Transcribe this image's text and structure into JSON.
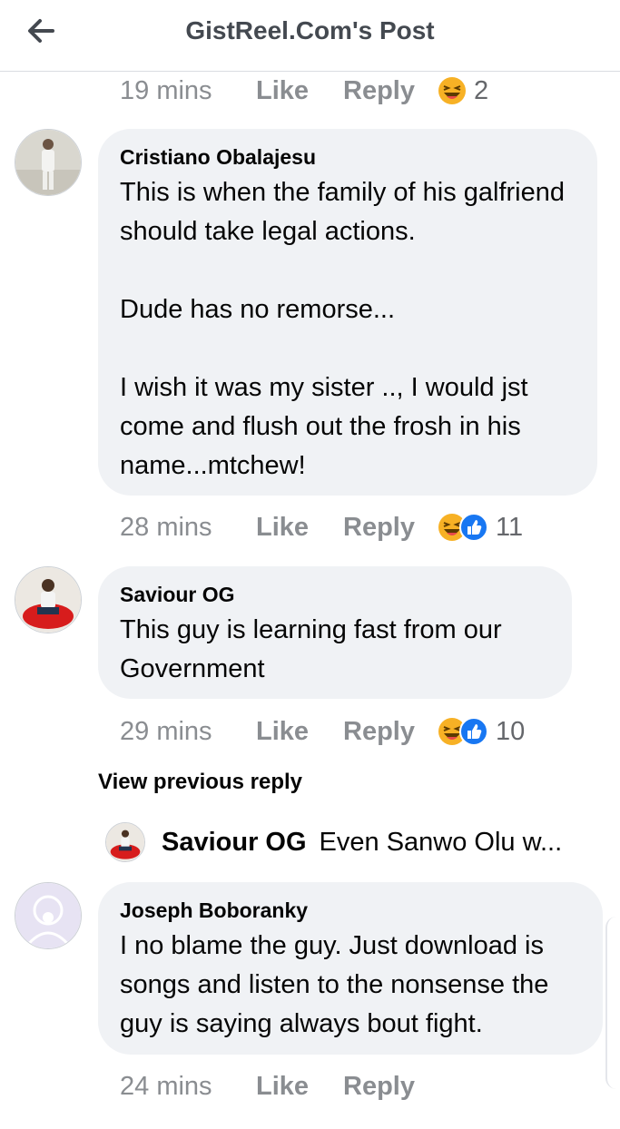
{
  "header": {
    "title": "GistReel.Com's Post",
    "back_icon": "arrow-left-icon"
  },
  "top_meta": {
    "time": "19 mins",
    "like": "Like",
    "reply": "Reply",
    "reaction_count": "2"
  },
  "comments": [
    {
      "author": "Cristiano Obalajesu",
      "text": "This is when the family of his galfriend should take legal actions.\n\nDude has no remorse...\n\nI wish it was my sister .., I would jst come and flush out the frosh in his name...mtchew!",
      "time": "28 mins",
      "like": "Like",
      "reply": "Reply",
      "reaction_count": "11"
    },
    {
      "author": "Saviour OG",
      "text": "This guy is learning fast from our Government",
      "time": "29 mins",
      "like": "Like",
      "reply": "Reply",
      "reaction_count": "10"
    },
    {
      "author": "Joseph Boboranky",
      "text": "I no blame the guy. Just download is songs and listen to the nonsense the guy is saying always bout fight.",
      "time": "24 mins",
      "like": "Like",
      "reply": "Reply"
    }
  ],
  "view_previous_reply": "View previous reply",
  "reply_preview": {
    "author": "Saviour OG",
    "text": "Even Sanwo Olu w..."
  },
  "colors": {
    "meta_text": "#8a8d91",
    "bubble_bg": "#f0f2f5",
    "haha_yellow": "#f7b125",
    "like_blue": "#1877f2"
  }
}
